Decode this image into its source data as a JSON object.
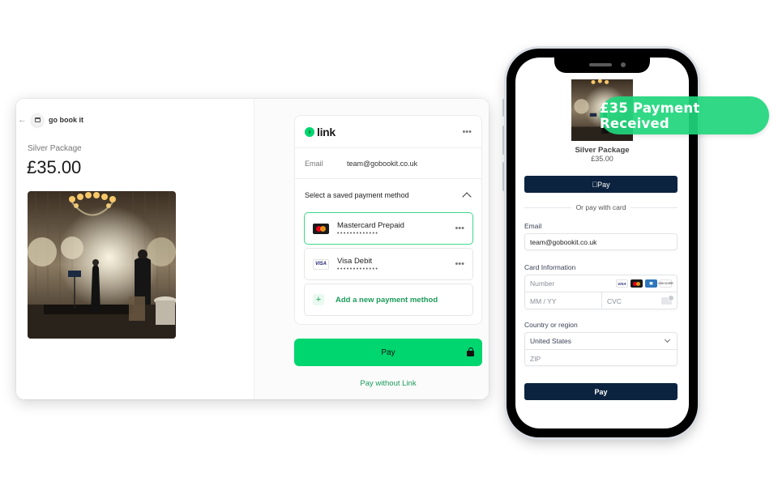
{
  "desktop": {
    "merchant_name": "go book it",
    "product_name": "Silver Package",
    "price": "£35.00",
    "product_image_alt": "Evening event stage with chandelier, singer and guest",
    "link": {
      "logo_text": "link",
      "menu_icon": "•••",
      "email_label": "Email",
      "email_value": "team@gobookit.co.uk",
      "saved_title": "Select a saved payment method",
      "payment_methods": [
        {
          "name": "Mastercard Prepaid",
          "mask": "•••••••••••••",
          "brand": "mastercard",
          "selected": true
        },
        {
          "name": "Visa Debit",
          "mask": "•••••••••••••",
          "brand": "visa",
          "selected": false
        }
      ],
      "visa_label": "VISA",
      "add_method_label": "Add a new payment method",
      "plus_icon": "+"
    },
    "pay_label": "Pay",
    "pay_without_link_label": "Pay without Link",
    "back_icon": "←"
  },
  "phone": {
    "product_name": "Silver Package",
    "price": "£35.00",
    "apple_pay_label": " Pay",
    "divider_text": "Or pay with card",
    "email_label": "Email",
    "email_value": "team@gobookit.co.uk",
    "card_info_label": "Card Information",
    "number_placeholder": "Number",
    "expiry_placeholder": "MM / YY",
    "cvc_placeholder": "CVC",
    "card_brands": [
      "VISA",
      "mastercard",
      "amex",
      "DISCOVER"
    ],
    "country_label": "Country or region",
    "country_value": "United States",
    "zip_placeholder": "ZIP",
    "pay_label": "Pay"
  },
  "badge": {
    "text": "£35 Payment Received"
  },
  "colors": {
    "link_green": "#00d66f",
    "link_text_green": "#1b9b5a",
    "navy": "#0c2340",
    "badge_green": "#20d67c"
  }
}
